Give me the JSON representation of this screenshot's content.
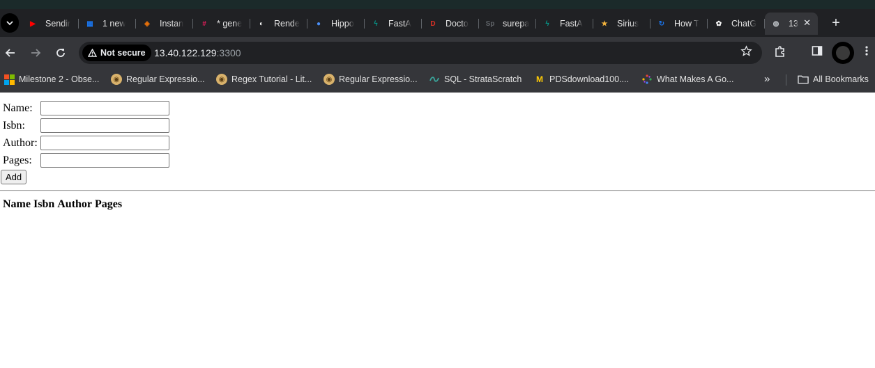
{
  "browser": {
    "tabs": [
      {
        "title": "Sendir",
        "icon": "youtube-icon",
        "color": "#ff0000"
      },
      {
        "title": "1 new",
        "icon": "grid-app-icon",
        "color": "#1a73e8"
      },
      {
        "title": "Instan",
        "icon": "instance-icon",
        "color": "#e8710a"
      },
      {
        "title": "* gene",
        "icon": "slack-icon",
        "color": "#e01e5a"
      },
      {
        "title": "Rende",
        "icon": "render-icon",
        "color": "#ffffff"
      },
      {
        "title": "Hippo",
        "icon": "hippo-icon",
        "color": "#4a8ff7"
      },
      {
        "title": "FastA",
        "icon": "fastapi-icon",
        "color": "#05998b"
      },
      {
        "title": "Docto",
        "icon": "docto-icon",
        "color": "#d93025"
      },
      {
        "title": "surepa",
        "icon": "sp-icon",
        "color": "#5f6368"
      },
      {
        "title": "FastA",
        "icon": "fastapi-icon",
        "color": "#05998b"
      },
      {
        "title": "Sirius",
        "icon": "sirius-icon",
        "color": "#f2b33d"
      },
      {
        "title": "How T",
        "icon": "how-to-icon",
        "color": "#1a73e8"
      },
      {
        "title": "ChatG",
        "icon": "chatgpt-icon",
        "color": "#ffffff"
      }
    ],
    "active_tab": {
      "title": "13",
      "icon": "globe-icon",
      "close": "✕"
    },
    "new_tab": "+",
    "security_label": "Not secure",
    "url_host": "13.40.122.129",
    "url_port": ":3300",
    "bookmarks": [
      {
        "label": "Milestone 2 - Obse...",
        "icon": "microsoft-icon"
      },
      {
        "label": "Regular Expressio...",
        "icon": "owl-icon"
      },
      {
        "label": "Regex Tutorial - Lit...",
        "icon": "owl-icon"
      },
      {
        "label": "Regular Expressio...",
        "icon": "owl-icon"
      },
      {
        "label": "SQL - StrataScratch",
        "icon": "stratascratch-icon"
      },
      {
        "label": "PDSdownload100....",
        "icon": "michigan-icon"
      },
      {
        "label": "What Makes A Go...",
        "icon": "sparkle-icon"
      }
    ],
    "all_bookmarks": "All Bookmarks"
  },
  "form": {
    "name_label": "Name:",
    "isbn_label": "Isbn:",
    "author_label": "Author:",
    "pages_label": "Pages:",
    "name_value": "",
    "isbn_value": "",
    "author_value": "",
    "pages_value": "",
    "add_button": "Add"
  },
  "table": {
    "headers": [
      "Name",
      "Isbn",
      "Author",
      "Pages"
    ]
  },
  "colors": {
    "tab_strip_bg": "#202124",
    "toolbar_bg": "#35363a"
  }
}
